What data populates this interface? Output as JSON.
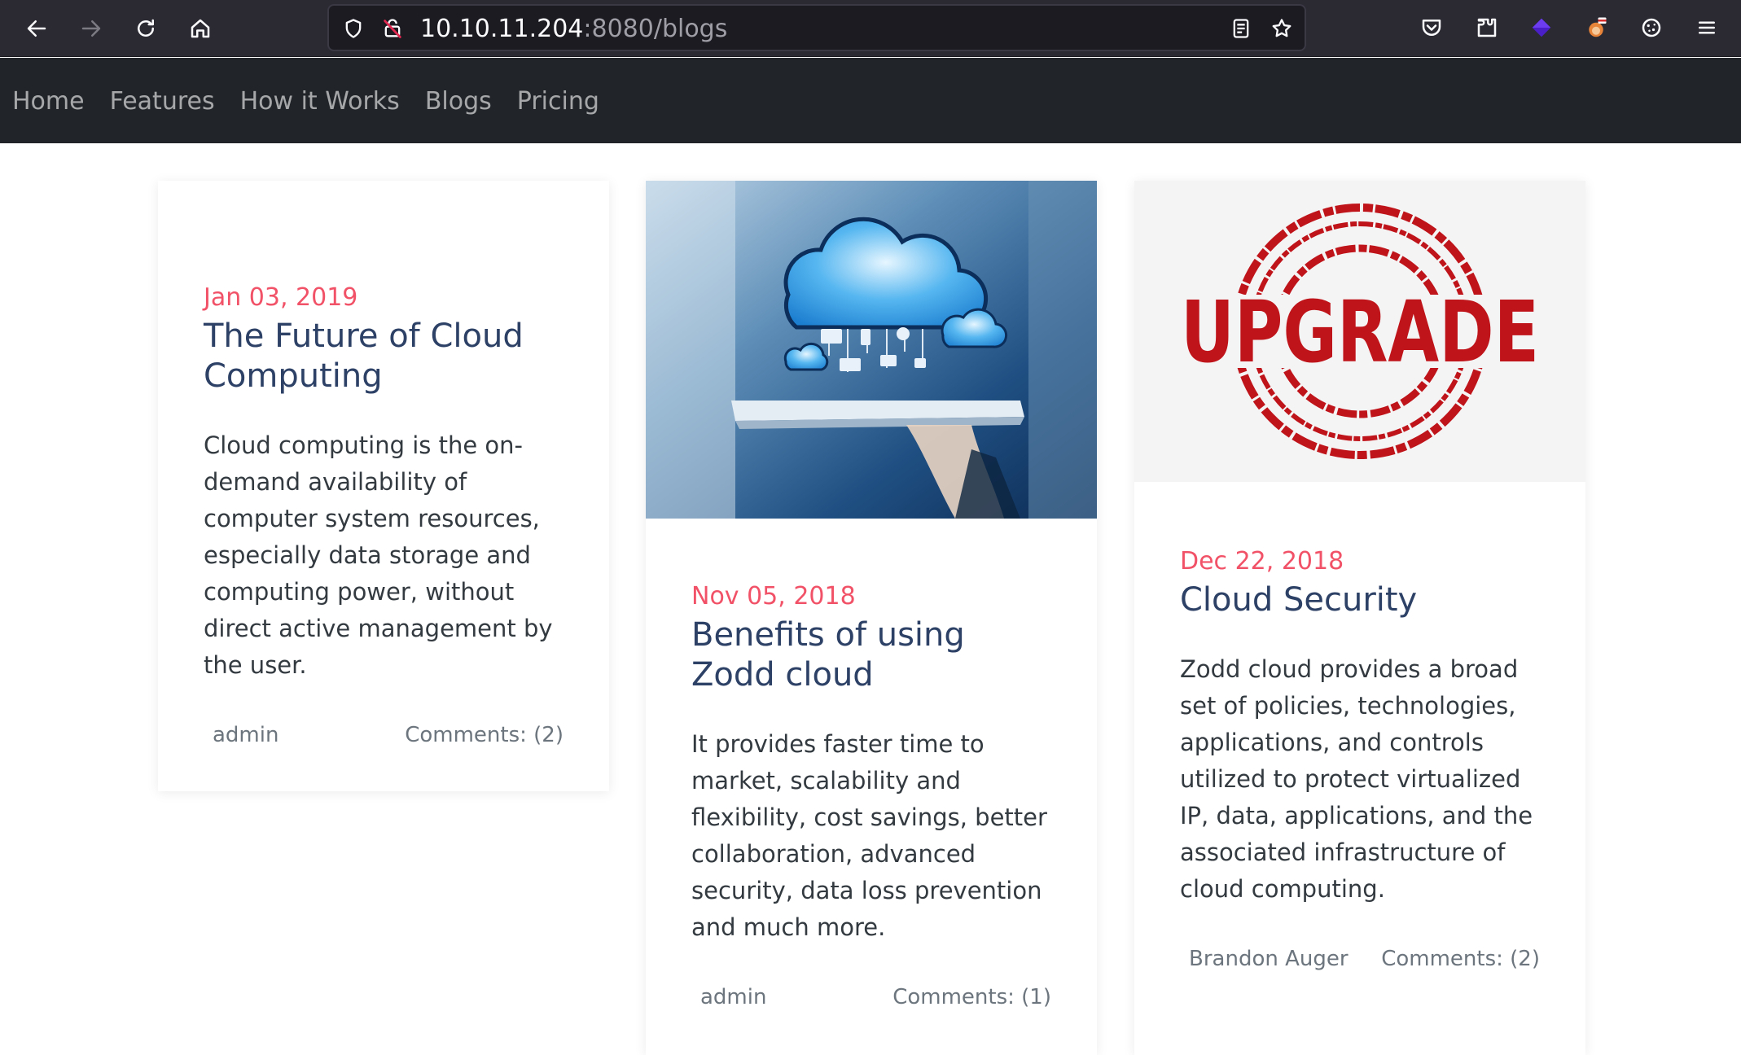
{
  "browser": {
    "url_host": "10.10.11.204",
    "url_path": ":8080/blogs"
  },
  "nav": {
    "items": [
      "Home",
      "Features",
      "How it Works",
      "Blogs",
      "Pricing"
    ]
  },
  "posts": [
    {
      "date": "Jan 03, 2019",
      "title": "The Future of Cloud Computing",
      "description": "Cloud computing is the on-demand availability of computer system resources, especially data storage and computing power, without direct active management by the user.",
      "author": "admin",
      "comments": "Comments: (2)"
    },
    {
      "date": "Nov 05, 2018",
      "title": "Benefits of using Zodd cloud",
      "description": "It provides faster time to market, scalability and flexibility, cost savings, better collaboration, advanced security, data loss prevention and much more.",
      "author": "admin",
      "comments": "Comments: (1)",
      "image_icon": "cloud-tablet-image"
    },
    {
      "date": "Dec 22, 2018",
      "title": "Cloud Security",
      "description": "Zodd cloud provides a broad set of policies, technologies, applications, and controls utilized to protect virtualized IP, data, applications, and the associated infrastructure of cloud computing.",
      "author": "Brandon Auger",
      "comments": "Comments: (2)",
      "image_text": "UPGRADE"
    }
  ],
  "colors": {
    "date": "#f25267",
    "title": "#2d4166",
    "navbar": "#212529",
    "browser": "#2b2a33"
  }
}
